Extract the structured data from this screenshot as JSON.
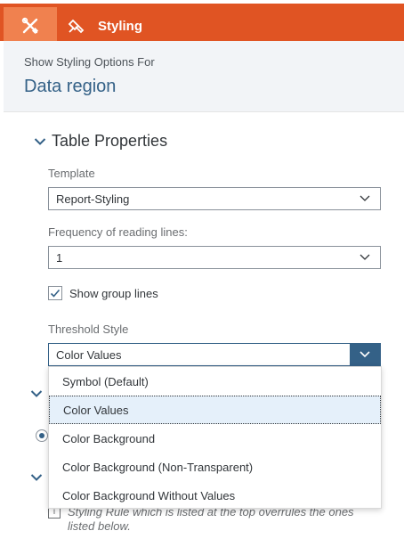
{
  "toolbar": {
    "tools_icon": "tools-icon",
    "styling_icon": "paint-brush-icon",
    "styling_label": "Styling",
    "bar_color": "#e05423",
    "active_tool_color": "#f0814f"
  },
  "header": {
    "hint": "Show Styling Options For",
    "region": "Data region"
  },
  "table_properties": {
    "title": "Table Properties",
    "template_label": "Template",
    "template_value": "Report-Styling",
    "reading_lines_label": "Frequency of reading lines:",
    "reading_lines_value": "1",
    "group_lines_label": "Show group lines",
    "group_lines_checked": true,
    "threshold_label": "Threshold Style",
    "threshold_value": "Color Values"
  },
  "threshold_options": [
    "Symbol (Default)",
    "Color Values",
    "Color Background",
    "Color Background (Non-Transparent)",
    "Color Background Without Values"
  ],
  "selected_option_index": 1,
  "info": {
    "icon": "info-icon",
    "text": "Styling Rule which is listed at the top overrules the ones listed below."
  },
  "colors": {
    "accent": "#346187",
    "selected_bg": "#e5f0fa"
  }
}
